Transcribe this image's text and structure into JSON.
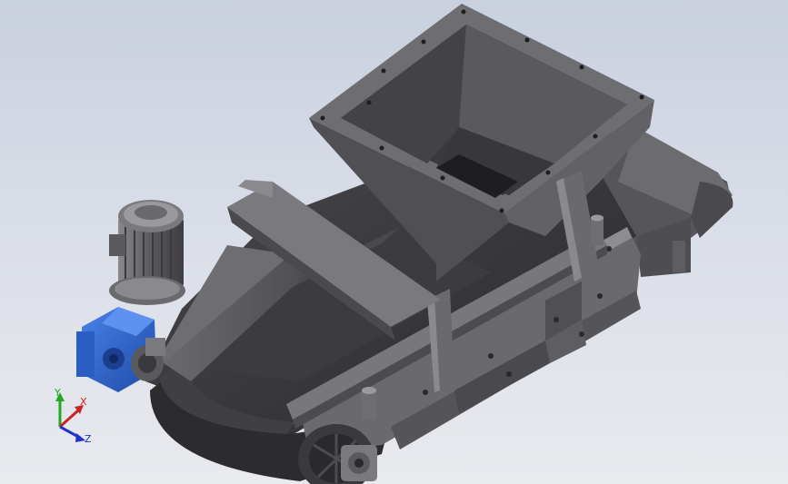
{
  "viewport": {
    "background_top": "#c9d0de",
    "background_bottom": "#e9eaee"
  },
  "model": {
    "steel_color": "#5a5a5e",
    "steel_dark": "#3a3a3d",
    "steel_light": "#8a8a8e",
    "motor_color": "#6a6a6e",
    "gearbox_color": "#2f63c6"
  },
  "triad": {
    "y_label": "Y",
    "x_label": "X",
    "z_label": "Z",
    "y_color": "#22aa22",
    "x_color": "#cc2222",
    "z_color": "#2233cc"
  }
}
